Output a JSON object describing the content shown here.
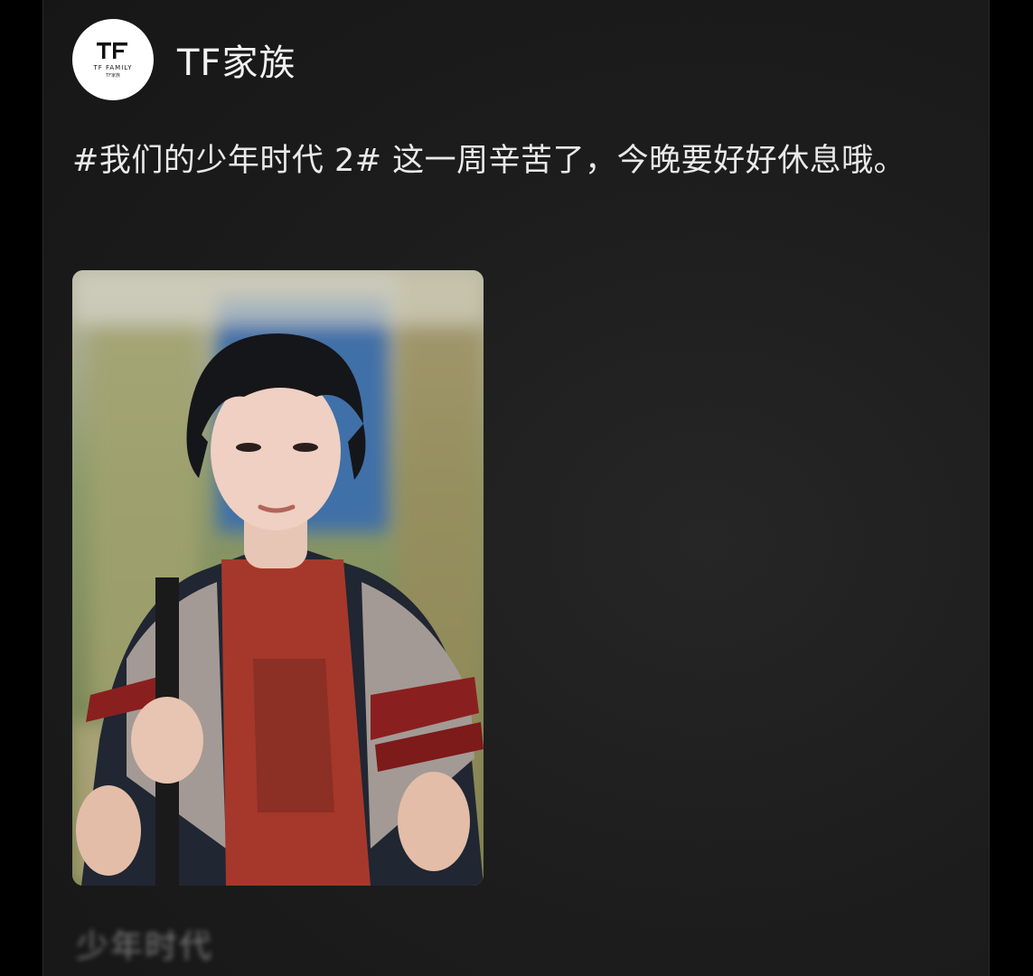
{
  "post": {
    "account_name": "TF家族",
    "avatar": {
      "logo_mark": "TF",
      "logo_name": "TF FAMILY",
      "logo_sub": "TF家族"
    },
    "text": "#我们的少年时代 2# 这一周辛苦了，今晚要好好休息哦。",
    "footer_text_blurred": "少年时代"
  },
  "colors": {
    "page_background": "#000000",
    "card_background": "#1d1d1d",
    "text_primary": "#e9e9e9",
    "avatar_background": "#ffffff"
  },
  "icons": {
    "avatar_logo": "tf-family-logo"
  }
}
